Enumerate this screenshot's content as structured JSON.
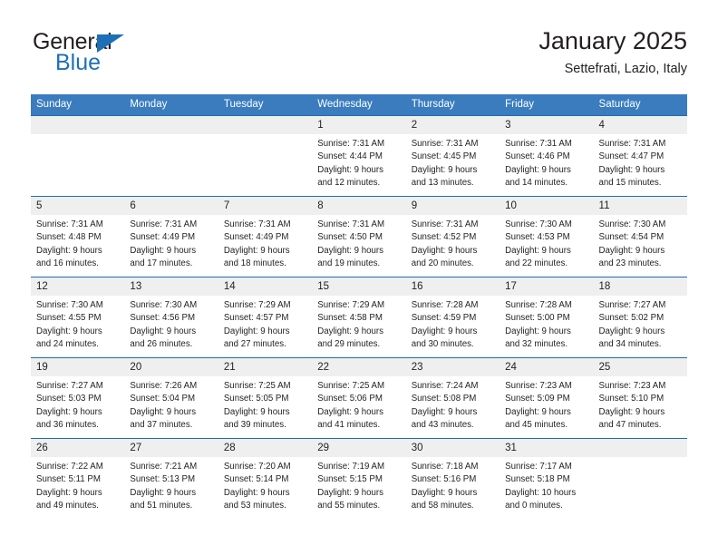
{
  "brand": {
    "name_top": "General",
    "name_bottom": "Blue",
    "accent_color": "#1d70b7"
  },
  "header": {
    "title": "January 2025",
    "subtitle": "Settefrati, Lazio, Italy"
  },
  "theme": {
    "header_bg": "#3a7cbe",
    "row_divider": "#1f6cb0",
    "daynum_bg": "#efefef",
    "text": "#231f20"
  },
  "calendar": {
    "weekday_headers": [
      "Sunday",
      "Monday",
      "Tuesday",
      "Wednesday",
      "Thursday",
      "Friday",
      "Saturday"
    ],
    "weeks": [
      [
        {
          "day": "",
          "lines": []
        },
        {
          "day": "",
          "lines": []
        },
        {
          "day": "",
          "lines": []
        },
        {
          "day": "1",
          "lines": [
            "Sunrise: 7:31 AM",
            "Sunset: 4:44 PM",
            "Daylight: 9 hours",
            "and 12 minutes."
          ]
        },
        {
          "day": "2",
          "lines": [
            "Sunrise: 7:31 AM",
            "Sunset: 4:45 PM",
            "Daylight: 9 hours",
            "and 13 minutes."
          ]
        },
        {
          "day": "3",
          "lines": [
            "Sunrise: 7:31 AM",
            "Sunset: 4:46 PM",
            "Daylight: 9 hours",
            "and 14 minutes."
          ]
        },
        {
          "day": "4",
          "lines": [
            "Sunrise: 7:31 AM",
            "Sunset: 4:47 PM",
            "Daylight: 9 hours",
            "and 15 minutes."
          ]
        }
      ],
      [
        {
          "day": "5",
          "lines": [
            "Sunrise: 7:31 AM",
            "Sunset: 4:48 PM",
            "Daylight: 9 hours",
            "and 16 minutes."
          ]
        },
        {
          "day": "6",
          "lines": [
            "Sunrise: 7:31 AM",
            "Sunset: 4:49 PM",
            "Daylight: 9 hours",
            "and 17 minutes."
          ]
        },
        {
          "day": "7",
          "lines": [
            "Sunrise: 7:31 AM",
            "Sunset: 4:49 PM",
            "Daylight: 9 hours",
            "and 18 minutes."
          ]
        },
        {
          "day": "8",
          "lines": [
            "Sunrise: 7:31 AM",
            "Sunset: 4:50 PM",
            "Daylight: 9 hours",
            "and 19 minutes."
          ]
        },
        {
          "day": "9",
          "lines": [
            "Sunrise: 7:31 AM",
            "Sunset: 4:52 PM",
            "Daylight: 9 hours",
            "and 20 minutes."
          ]
        },
        {
          "day": "10",
          "lines": [
            "Sunrise: 7:30 AM",
            "Sunset: 4:53 PM",
            "Daylight: 9 hours",
            "and 22 minutes."
          ]
        },
        {
          "day": "11",
          "lines": [
            "Sunrise: 7:30 AM",
            "Sunset: 4:54 PM",
            "Daylight: 9 hours",
            "and 23 minutes."
          ]
        }
      ],
      [
        {
          "day": "12",
          "lines": [
            "Sunrise: 7:30 AM",
            "Sunset: 4:55 PM",
            "Daylight: 9 hours",
            "and 24 minutes."
          ]
        },
        {
          "day": "13",
          "lines": [
            "Sunrise: 7:30 AM",
            "Sunset: 4:56 PM",
            "Daylight: 9 hours",
            "and 26 minutes."
          ]
        },
        {
          "day": "14",
          "lines": [
            "Sunrise: 7:29 AM",
            "Sunset: 4:57 PM",
            "Daylight: 9 hours",
            "and 27 minutes."
          ]
        },
        {
          "day": "15",
          "lines": [
            "Sunrise: 7:29 AM",
            "Sunset: 4:58 PM",
            "Daylight: 9 hours",
            "and 29 minutes."
          ]
        },
        {
          "day": "16",
          "lines": [
            "Sunrise: 7:28 AM",
            "Sunset: 4:59 PM",
            "Daylight: 9 hours",
            "and 30 minutes."
          ]
        },
        {
          "day": "17",
          "lines": [
            "Sunrise: 7:28 AM",
            "Sunset: 5:00 PM",
            "Daylight: 9 hours",
            "and 32 minutes."
          ]
        },
        {
          "day": "18",
          "lines": [
            "Sunrise: 7:27 AM",
            "Sunset: 5:02 PM",
            "Daylight: 9 hours",
            "and 34 minutes."
          ]
        }
      ],
      [
        {
          "day": "19",
          "lines": [
            "Sunrise: 7:27 AM",
            "Sunset: 5:03 PM",
            "Daylight: 9 hours",
            "and 36 minutes."
          ]
        },
        {
          "day": "20",
          "lines": [
            "Sunrise: 7:26 AM",
            "Sunset: 5:04 PM",
            "Daylight: 9 hours",
            "and 37 minutes."
          ]
        },
        {
          "day": "21",
          "lines": [
            "Sunrise: 7:25 AM",
            "Sunset: 5:05 PM",
            "Daylight: 9 hours",
            "and 39 minutes."
          ]
        },
        {
          "day": "22",
          "lines": [
            "Sunrise: 7:25 AM",
            "Sunset: 5:06 PM",
            "Daylight: 9 hours",
            "and 41 minutes."
          ]
        },
        {
          "day": "23",
          "lines": [
            "Sunrise: 7:24 AM",
            "Sunset: 5:08 PM",
            "Daylight: 9 hours",
            "and 43 minutes."
          ]
        },
        {
          "day": "24",
          "lines": [
            "Sunrise: 7:23 AM",
            "Sunset: 5:09 PM",
            "Daylight: 9 hours",
            "and 45 minutes."
          ]
        },
        {
          "day": "25",
          "lines": [
            "Sunrise: 7:23 AM",
            "Sunset: 5:10 PM",
            "Daylight: 9 hours",
            "and 47 minutes."
          ]
        }
      ],
      [
        {
          "day": "26",
          "lines": [
            "Sunrise: 7:22 AM",
            "Sunset: 5:11 PM",
            "Daylight: 9 hours",
            "and 49 minutes."
          ]
        },
        {
          "day": "27",
          "lines": [
            "Sunrise: 7:21 AM",
            "Sunset: 5:13 PM",
            "Daylight: 9 hours",
            "and 51 minutes."
          ]
        },
        {
          "day": "28",
          "lines": [
            "Sunrise: 7:20 AM",
            "Sunset: 5:14 PM",
            "Daylight: 9 hours",
            "and 53 minutes."
          ]
        },
        {
          "day": "29",
          "lines": [
            "Sunrise: 7:19 AM",
            "Sunset: 5:15 PM",
            "Daylight: 9 hours",
            "and 55 minutes."
          ]
        },
        {
          "day": "30",
          "lines": [
            "Sunrise: 7:18 AM",
            "Sunset: 5:16 PM",
            "Daylight: 9 hours",
            "and 58 minutes."
          ]
        },
        {
          "day": "31",
          "lines": [
            "Sunrise: 7:17 AM",
            "Sunset: 5:18 PM",
            "Daylight: 10 hours",
            "and 0 minutes."
          ]
        },
        {
          "day": "",
          "lines": []
        }
      ]
    ]
  }
}
